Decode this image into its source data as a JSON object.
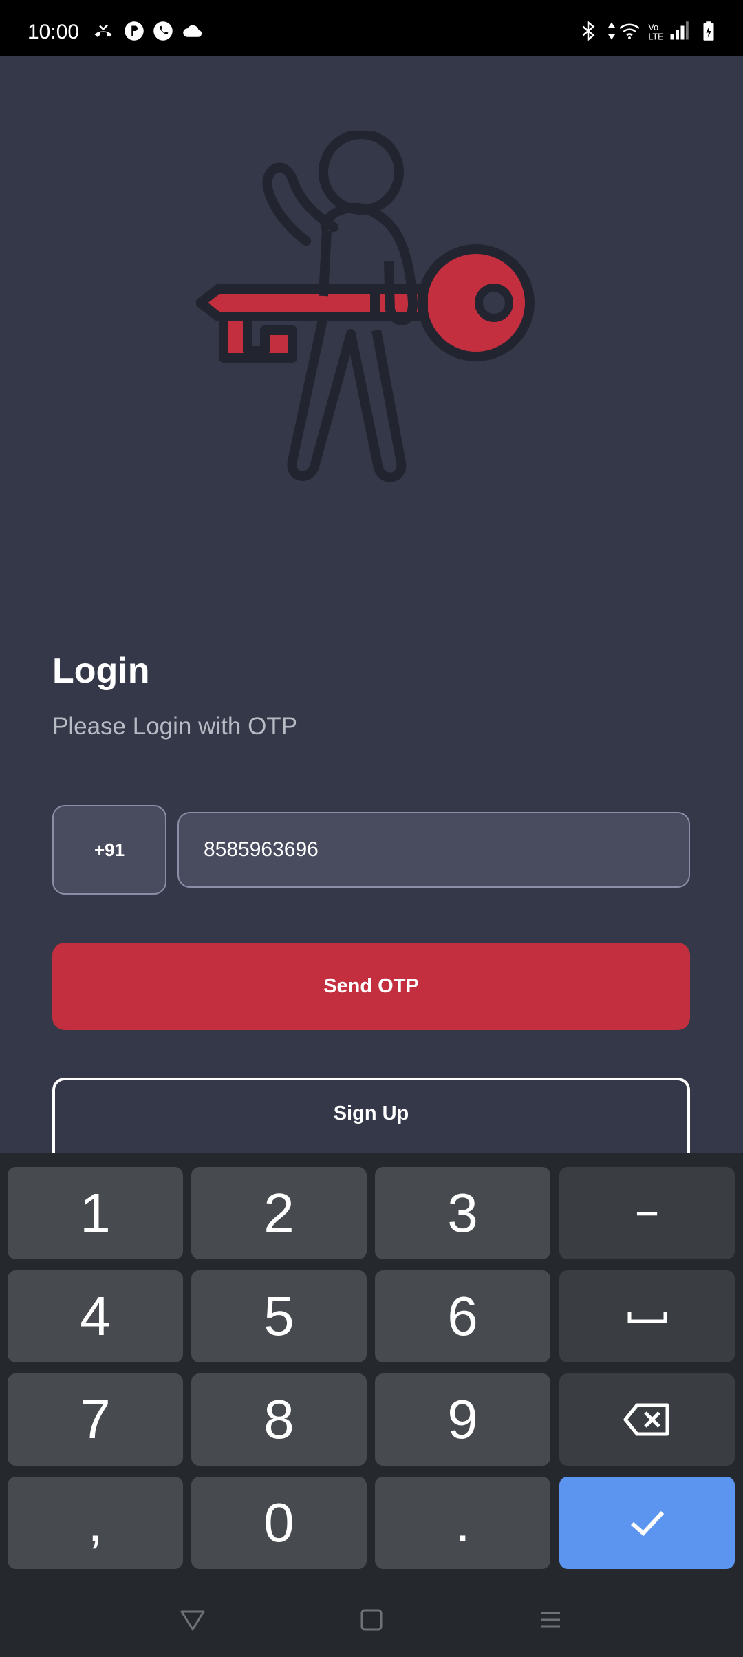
{
  "status_bar": {
    "time": "10:00",
    "left_icons": [
      "missed-call-icon",
      "app-notification-icon",
      "whatsapp-icon",
      "cloud-icon"
    ],
    "right_icons": [
      "bluetooth-icon",
      "data-arrows-icon",
      "wifi-icon",
      "volte-icon",
      "signal-icon",
      "battery-charging-icon"
    ]
  },
  "login": {
    "title": "Login",
    "subtitle": "Please Login with OTP",
    "country_code": "+91",
    "phone_value": "8585963696",
    "send_otp_label": "Send OTP",
    "signup_label": "Sign Up"
  },
  "keyboard": {
    "keys": [
      {
        "label": "1",
        "name": "key-1"
      },
      {
        "label": "2",
        "name": "key-2"
      },
      {
        "label": "3",
        "name": "key-3"
      },
      {
        "label": "−",
        "name": "key-minus"
      },
      {
        "label": "4",
        "name": "key-4"
      },
      {
        "label": "5",
        "name": "key-5"
      },
      {
        "label": "6",
        "name": "key-6"
      },
      {
        "label": "␣",
        "name": "key-space"
      },
      {
        "label": "7",
        "name": "key-7"
      },
      {
        "label": "8",
        "name": "key-8"
      },
      {
        "label": "9",
        "name": "key-9"
      },
      {
        "label": "⌫",
        "name": "key-backspace"
      },
      {
        "label": ",",
        "name": "key-comma"
      },
      {
        "label": "0",
        "name": "key-0"
      },
      {
        "label": ".",
        "name": "key-period"
      },
      {
        "label": "✓",
        "name": "key-enter"
      }
    ]
  },
  "nav_bar": {
    "icons": [
      "back-icon",
      "home-icon",
      "recents-icon"
    ]
  },
  "colors": {
    "background": "#343849",
    "accent": "#c32f3e",
    "input_bg": "#494c5f",
    "enter_key": "#5b95f0"
  }
}
